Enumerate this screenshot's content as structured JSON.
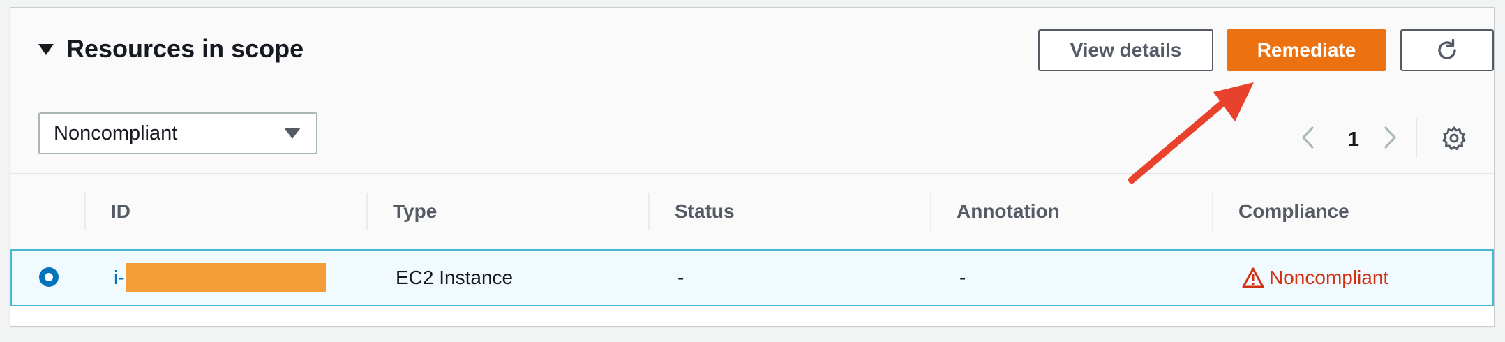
{
  "panel": {
    "title": "Resources in scope",
    "buttons": {
      "view_details": "View details",
      "remediate": "Remediate",
      "refresh_icon": "refresh-icon"
    }
  },
  "filter": {
    "selected": "Noncompliant"
  },
  "pagination": {
    "current_page": "1"
  },
  "table": {
    "columns": [
      "ID",
      "Type",
      "Status",
      "Annotation",
      "Compliance"
    ],
    "rows": [
      {
        "selected": true,
        "id": "i-",
        "type": "EC2 Instance",
        "status": "-",
        "annotation": "-",
        "compliance": "Noncompliant"
      }
    ]
  },
  "colors": {
    "accent": "#ec7211",
    "link": "#0073bb",
    "noncompliant": "#d13212",
    "annotation_arrow": "#e8412c",
    "redaction": "#f29d38"
  }
}
